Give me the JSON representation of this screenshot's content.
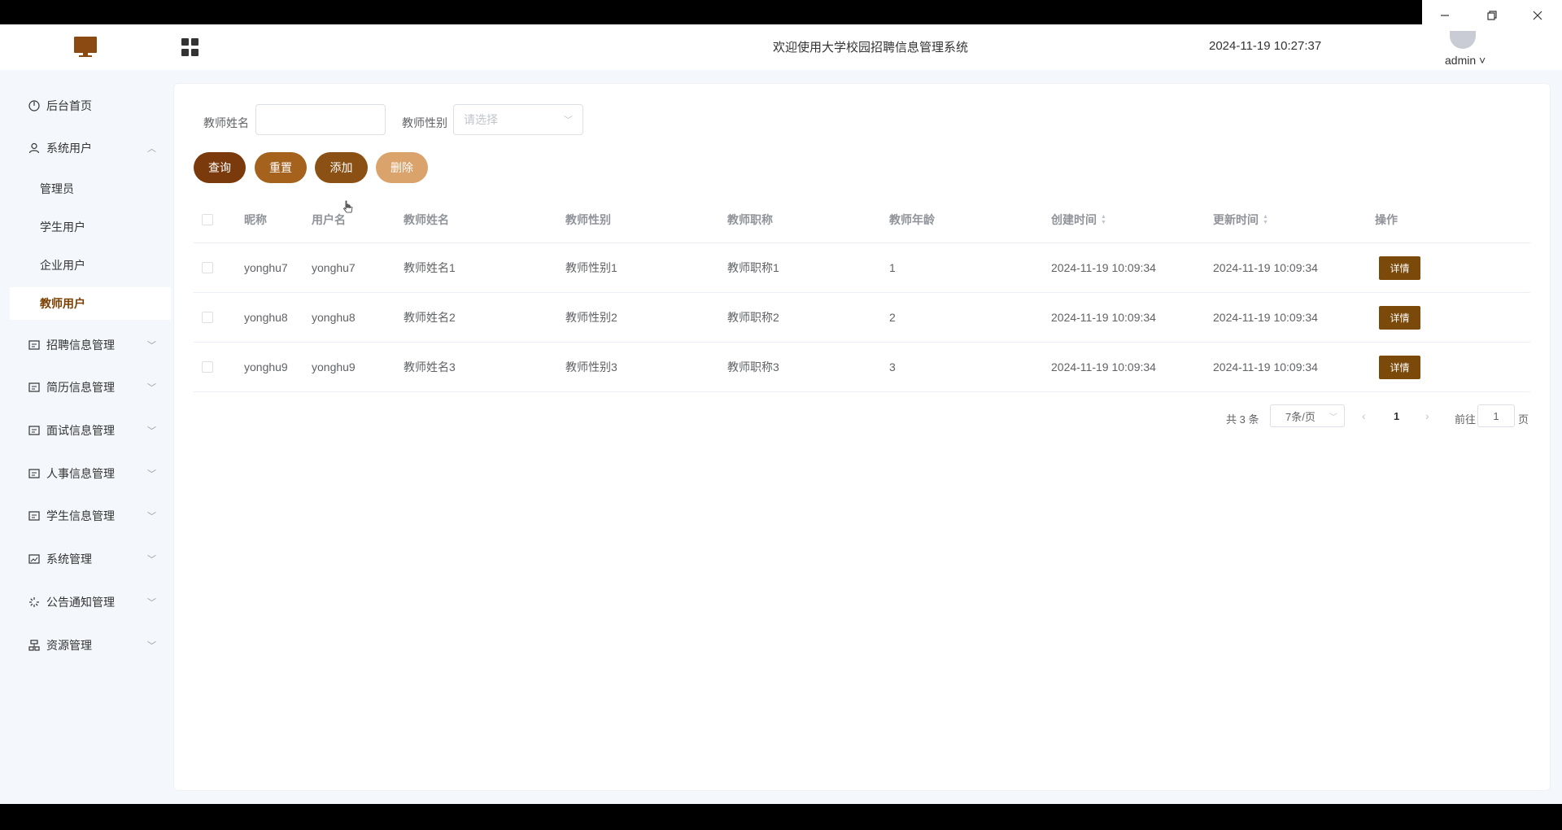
{
  "window": {
    "minimize_icon": "minimize-icon",
    "maximize_icon": "restore-icon",
    "close_icon": "close-icon"
  },
  "header": {
    "title": "欢迎使用大学校园招聘信息管理系统",
    "datetime": "2024-11-19 10:27:37",
    "user": "admin ˅"
  },
  "sidebar": {
    "items": [
      {
        "label": "后台首页",
        "icon": "dashboard-icon"
      },
      {
        "label": "系统用户",
        "icon": "user-icon",
        "expanded": true
      },
      {
        "label": "招聘信息管理",
        "icon": "list-icon"
      },
      {
        "label": "简历信息管理",
        "icon": "list-icon"
      },
      {
        "label": "面试信息管理",
        "icon": "list-icon"
      },
      {
        "label": "人事信息管理",
        "icon": "list-icon"
      },
      {
        "label": "学生信息管理",
        "icon": "list-icon"
      },
      {
        "label": "系统管理",
        "icon": "chart-icon"
      },
      {
        "label": "公告通知管理",
        "icon": "loading-icon"
      },
      {
        "label": "资源管理",
        "icon": "network-icon"
      }
    ],
    "sub_items": [
      {
        "label": "管理员"
      },
      {
        "label": "学生用户"
      },
      {
        "label": "企业用户"
      },
      {
        "label": "教师用户",
        "active": true
      }
    ]
  },
  "search": {
    "name_label": "教师姓名",
    "name_value": "",
    "gender_label": "教师性别",
    "gender_placeholder": "请选择"
  },
  "buttons": {
    "query": "查询",
    "reset": "重置",
    "add": "添加",
    "delete": "删除",
    "colors": {
      "query": "#7b3a0c",
      "reset": "#a5621d",
      "add": "#8a5014",
      "delete": "#d9a36b"
    }
  },
  "table": {
    "headers": [
      "昵称",
      "用户名",
      "教师姓名",
      "教师性别",
      "教师职称",
      "教师年龄",
      "创建时间",
      "更新时间",
      "操作"
    ],
    "rows": [
      [
        "yonghu7",
        "yonghu7",
        "教师姓名1",
        "教师性别1",
        "教师职称1",
        "1",
        "2024-11-19 10:09:34",
        "2024-11-19 10:09:34",
        "详情"
      ],
      [
        "yonghu8",
        "yonghu8",
        "教师姓名2",
        "教师性别2",
        "教师职称2",
        "2",
        "2024-11-19 10:09:34",
        "2024-11-19 10:09:34",
        "详情"
      ],
      [
        "yonghu9",
        "yonghu9",
        "教师姓名3",
        "教师性别3",
        "教师职称3",
        "3",
        "2024-11-19 10:09:34",
        "2024-11-19 10:09:34",
        "详情"
      ]
    ]
  },
  "pagination": {
    "total": "共 3 条",
    "page_size": "7条/页",
    "current_page": "1",
    "goto_label": "前往",
    "goto_value": "1",
    "page_suffix": "页"
  },
  "colors": {
    "accent": "#7b3f00",
    "detail_button": "#7b4a0b"
  }
}
